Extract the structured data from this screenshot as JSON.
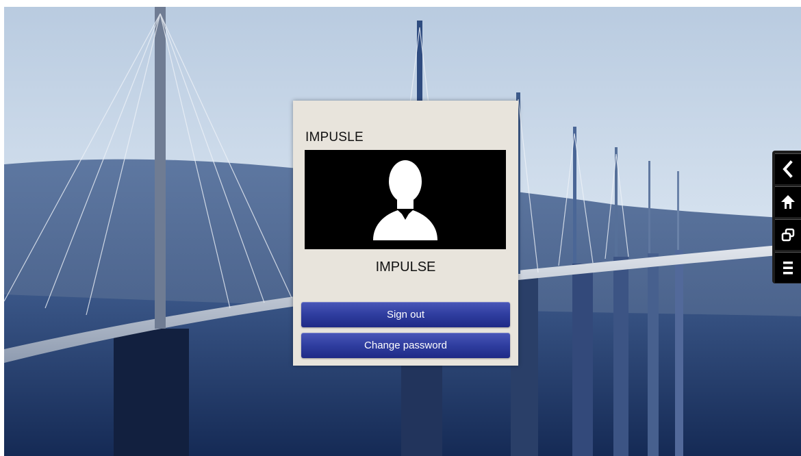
{
  "dialog": {
    "title": "IMPUSLE",
    "user_name": "IMPULSE",
    "avatar_icon": "user-silhouette-icon",
    "buttons": {
      "sign_out": "Sign out",
      "change_password": "Change password"
    }
  },
  "side_nav": {
    "items": [
      {
        "icon": "back-icon"
      },
      {
        "icon": "home-icon"
      },
      {
        "icon": "windows-icon"
      },
      {
        "icon": "menu-icon"
      }
    ]
  },
  "colors": {
    "button_blue": "#2f3d9f",
    "dialog_bg": "#e8e4dc",
    "sky": "#c8d8ea",
    "nav_bg": "#000000"
  }
}
